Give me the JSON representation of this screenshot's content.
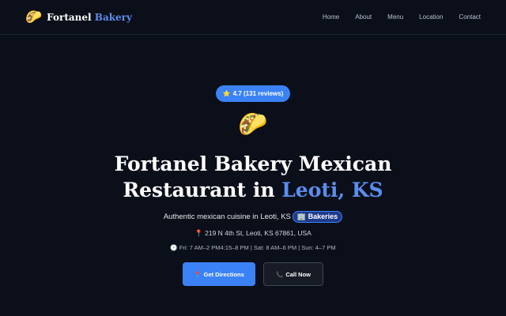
{
  "nav": {
    "brand_icon": "🌮",
    "brand_primary": "Fortanel",
    "brand_accent": "Bakery",
    "links": [
      "Home",
      "About",
      "Menu",
      "Location",
      "Contact"
    ]
  },
  "hero": {
    "rating_icon": "⭐",
    "rating_text": "4.7 (131 reviews)",
    "emoji": "🌮",
    "title_main": "Fortanel Bakery Mexican Restaurant in ",
    "title_accent": "Leoti, KS",
    "tagline": "Authentic mexican cuisine in Leoti, KS",
    "category_icon": "🏢",
    "category": "Bakeries",
    "address_icon": "📍",
    "address": "219 N 4th St, Leoti, KS 67861, USA",
    "hours_icon": "🕒",
    "hours": "Fri: 7 AM–2 PM4:15–8 PM | Sat: 8 AM–6 PM | Sun: 4–7 PM",
    "directions_icon": "📍",
    "directions_label": "Get Directions",
    "call_icon": "📞",
    "call_label": "Call Now"
  },
  "colors": {
    "background": "#0b0f19",
    "accent": "#3b82f6",
    "accent_text": "#5b8def"
  }
}
